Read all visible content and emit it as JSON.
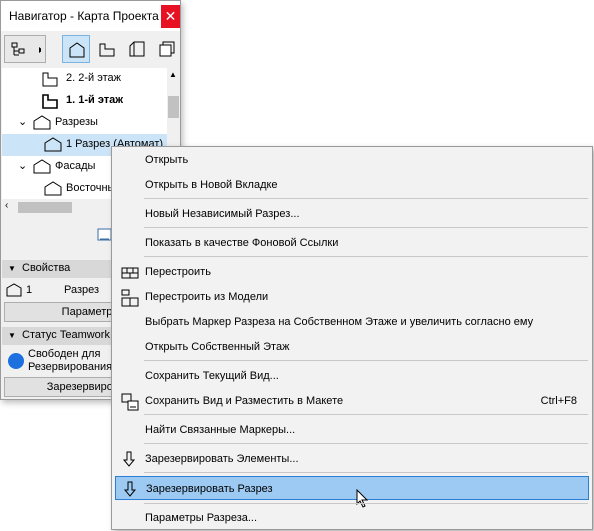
{
  "navigator": {
    "title": "Навигатор - Карта Проекта",
    "close_glyph": "✕",
    "tree": [
      {
        "label": "2. 2-й этаж",
        "bold": false
      },
      {
        "label": "1. 1-й этаж",
        "bold": true
      },
      {
        "label": "Разрезы",
        "bold": false
      },
      {
        "label": "1 Разрез (Автомат)",
        "bold": false
      },
      {
        "label": "Фасады",
        "bold": false
      },
      {
        "label": "Восточный",
        "bold": false
      }
    ],
    "properties_header": "Свойства",
    "properties_id": "1",
    "properties_name": "Разрез",
    "params_button": "Параметры",
    "teamwork_header": "Статус Teamwork",
    "teamwork_status": "Свободен для Резервирования",
    "reserve_button": "Зарезервировать"
  },
  "menu": {
    "items": [
      {
        "label": "Открыть"
      },
      {
        "label": "Открыть в Новой Вкладке"
      },
      {
        "label": "Новый Независимый Разрез..."
      },
      {
        "label": "Показать в качестве Фоновой Ссылки"
      },
      {
        "label": "Перестроить"
      },
      {
        "label": "Перестроить из Модели"
      },
      {
        "label": "Выбрать Маркер Разреза на Собственном Этаже и увеличить согласно ему"
      },
      {
        "label": "Открыть Собственный Этаж"
      },
      {
        "label": "Сохранить Текущий Вид..."
      },
      {
        "label": "Сохранить Вид и Разместить в Макете",
        "shortcut": "Ctrl+F8"
      },
      {
        "label": "Найти Связанные Маркеры..."
      },
      {
        "label": "Зарезервировать Элементы..."
      },
      {
        "label": "Зарезервировать Разрез"
      },
      {
        "label": "Параметры Разреза..."
      }
    ]
  },
  "colors": {
    "highlight": "#9ccaf2",
    "highlight_border": "#2a7fd4",
    "close": "#e81123",
    "teamwork_dot": "#1e6fe0",
    "selection": "#cce4f7"
  }
}
